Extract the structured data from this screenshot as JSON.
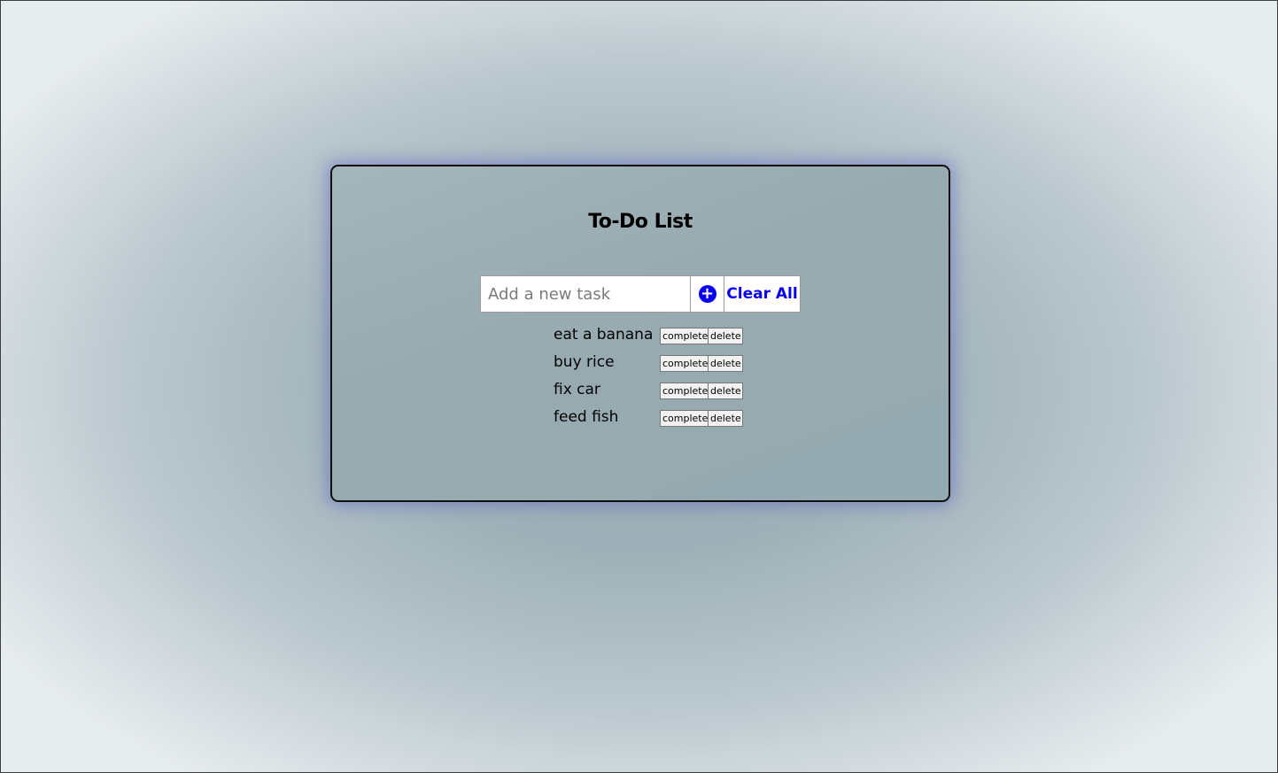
{
  "app": {
    "title": "To-Do List"
  },
  "entry": {
    "placeholder": "Add a new task",
    "value": "",
    "add_icon": "plus-circle-icon",
    "add_symbol": "+",
    "clear_label": "Clear All"
  },
  "tasks": [
    {
      "text": "eat a banana",
      "complete_label": "complete",
      "delete_label": "delete"
    },
    {
      "text": "buy rice",
      "complete_label": "complete",
      "delete_label": "delete"
    },
    {
      "text": "fix car",
      "complete_label": "complete",
      "delete_label": "delete"
    },
    {
      "text": "feed fish",
      "complete_label": "complete",
      "delete_label": "delete"
    }
  ],
  "colors": {
    "accent": "#0a00f0",
    "card_glow": "#5055be",
    "card_border": "#101010"
  }
}
